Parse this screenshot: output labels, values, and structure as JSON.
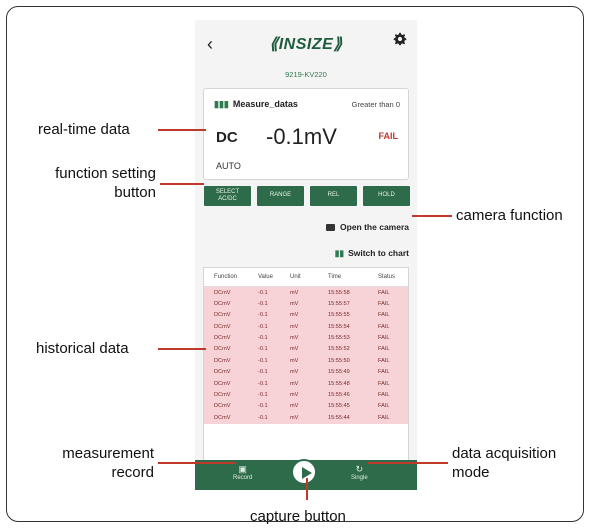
{
  "app": {
    "back_icon": "chevron-left-icon",
    "logo": "⟪INSIZE⟫",
    "settings_icon": "gear-icon",
    "device": "9219-KV220"
  },
  "measure": {
    "title": "Measure_datas",
    "condition": "Greater than 0",
    "function": "DC",
    "value": "-0.1mV",
    "status": "FAIL",
    "range_mode": "AUTO"
  },
  "function_buttons": [
    "SELECT\nAC/DC",
    "RANGE",
    "REL",
    "HOLD"
  ],
  "links": {
    "camera": "Open the camera",
    "chart": "Switch to chart"
  },
  "table": {
    "headers": [
      "Function",
      "Value",
      "Unit",
      "Time",
      "Status"
    ],
    "rows": [
      [
        "DCmV",
        "-0.1",
        "mV",
        "15:55:58",
        "FAIL"
      ],
      [
        "DCmV",
        "-0.1",
        "mV",
        "15:55:57",
        "FAIL"
      ],
      [
        "DCmV",
        "-0.1",
        "mV",
        "15:55:55",
        "FAIL"
      ],
      [
        "DCmV",
        "-0.1",
        "mV",
        "15:55:54",
        "FAIL"
      ],
      [
        "DCmV",
        "-0.1",
        "mV",
        "15:55:53",
        "FAIL"
      ],
      [
        "DCmV",
        "-0.1",
        "mV",
        "15:55:52",
        "FAIL"
      ],
      [
        "DCmV",
        "-0.1",
        "mV",
        "15:55:50",
        "FAIL"
      ],
      [
        "DCmV",
        "-0.1",
        "mV",
        "15:55:49",
        "FAIL"
      ],
      [
        "DCmV",
        "-0.1",
        "mV",
        "15:55:48",
        "FAIL"
      ],
      [
        "DCmV",
        "-0.1",
        "mV",
        "15:55:46",
        "FAIL"
      ],
      [
        "DCmV",
        "-0.1",
        "mV",
        "15:55:45",
        "FAIL"
      ],
      [
        "DCmV",
        "-0.1",
        "mV",
        "15:55:44",
        "FAIL"
      ]
    ]
  },
  "bottom_bar": {
    "record_label": "Record",
    "single_label": "Single"
  },
  "annotations": {
    "realtime": "real-time data",
    "function_setting": "function setting\nbutton",
    "camera": "camera function",
    "historical": "historical data",
    "measurement_record": "measurement\nrecord",
    "acquisition": "data acquisition\nmode",
    "capture": "capture button"
  },
  "colors": {
    "brand_green": "#2e6b4a",
    "fail_red": "#c0392b",
    "row_pink": "#f7d2d6",
    "annotation_line": "#c0392b"
  }
}
